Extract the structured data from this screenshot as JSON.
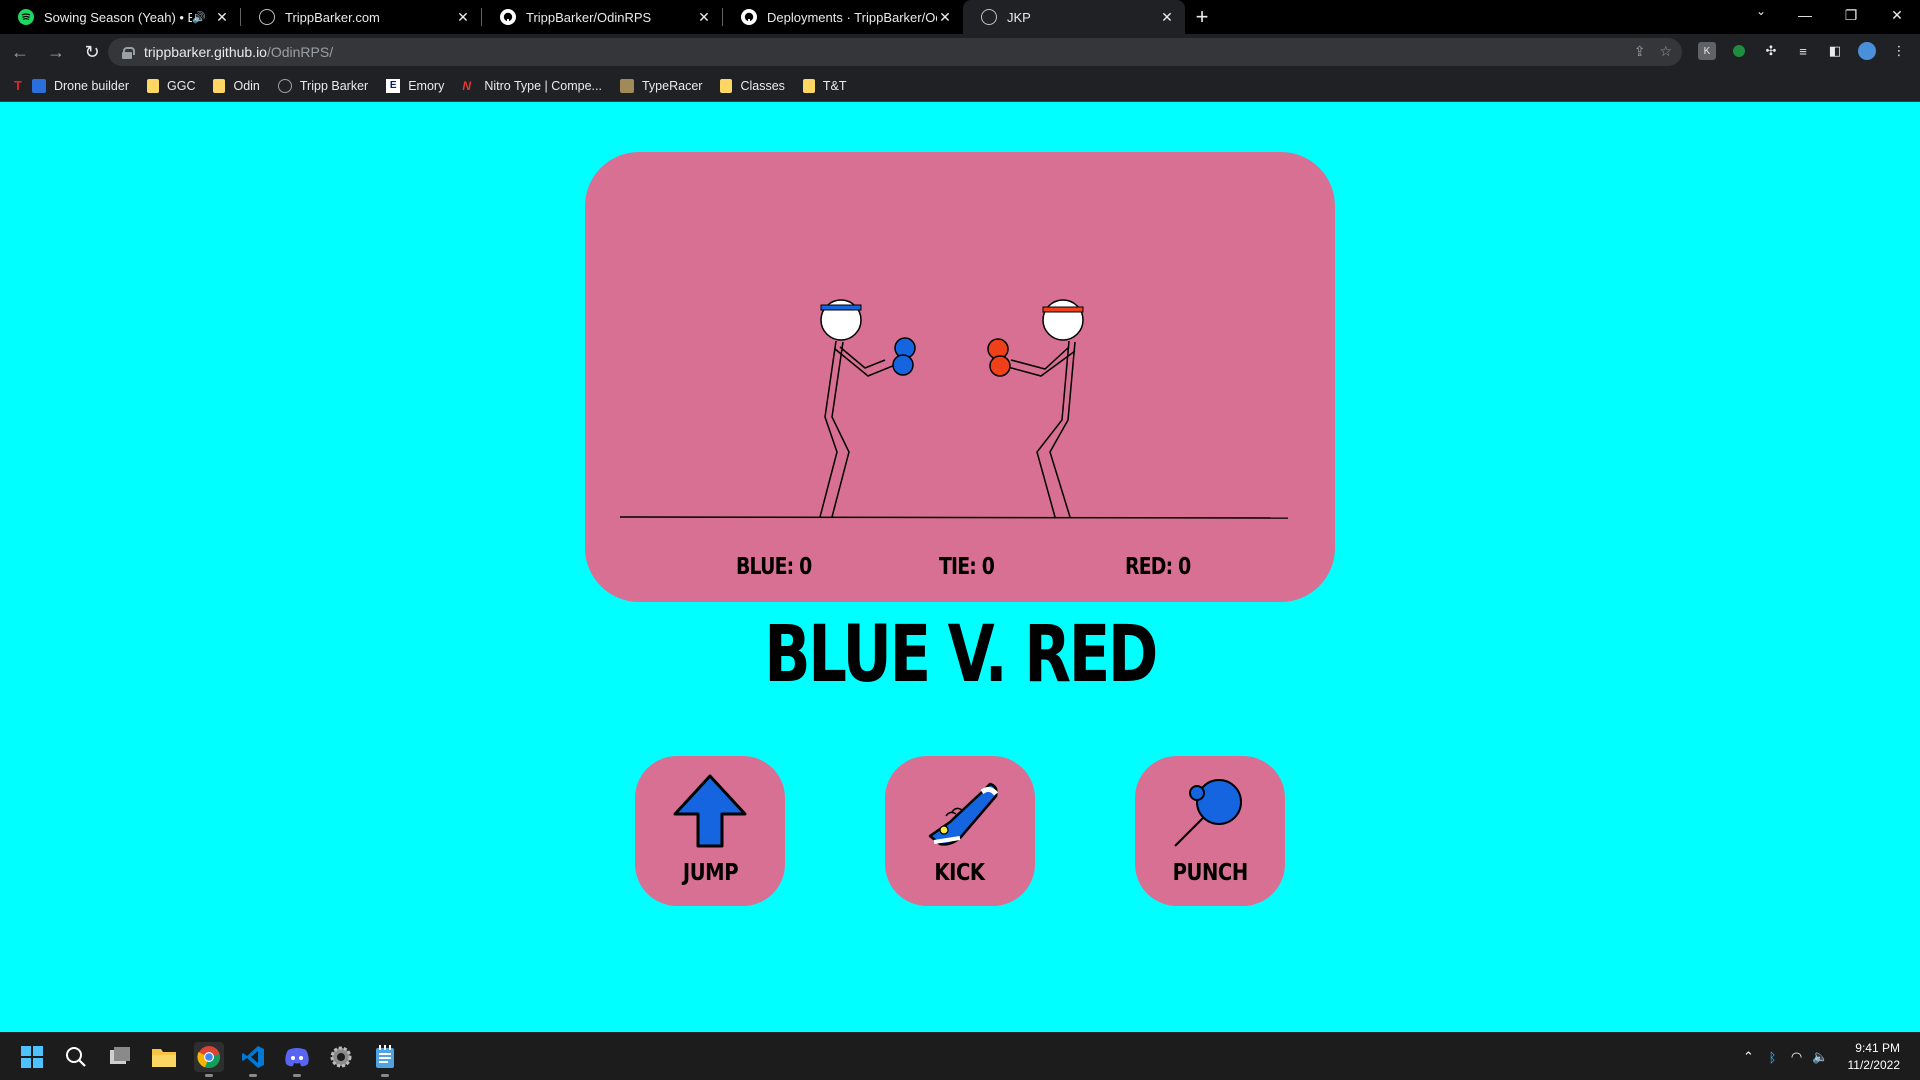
{
  "browser": {
    "tabs": [
      {
        "title": "Sowing Season (Yeah) • Bran",
        "icon": "spotify-icon",
        "audio": true,
        "active": false
      },
      {
        "title": "TrippBarker.com",
        "icon": "globe-icon",
        "active": false
      },
      {
        "title": "TrippBarker/OdinRPS",
        "icon": "github-icon",
        "active": false
      },
      {
        "title": "Deployments · TrippBarker/OdinF",
        "icon": "github-icon",
        "active": false
      },
      {
        "title": "JKP",
        "icon": "globe-icon",
        "active": true
      }
    ],
    "url_host": "trippbarker.github.io",
    "url_path": "/OdinRPS/",
    "bookmarks": [
      {
        "label": "Drone builder",
        "icon": "drone-icon"
      },
      {
        "label": "GGC",
        "icon": "folder-icon"
      },
      {
        "label": "Odin",
        "icon": "folder-icon"
      },
      {
        "label": "Tripp Barker",
        "icon": "globe-icon"
      },
      {
        "label": "Emory",
        "icon": "emory-icon"
      },
      {
        "label": "Nitro Type | Compe...",
        "icon": "nitro-icon"
      },
      {
        "label": "TypeRacer",
        "icon": "typeracer-icon"
      },
      {
        "label": "Classes",
        "icon": "folder-icon"
      },
      {
        "label": "T&T",
        "icon": "folder-icon"
      }
    ]
  },
  "game": {
    "background_color": "#00ffff",
    "panel_color": "#d87093",
    "blue_color": "#1565e0",
    "red_color": "#f0401a",
    "scores": {
      "blue": "BLUE: 0",
      "tie": "TIE: 0",
      "red": "RED: 0"
    },
    "headline": "BLUE V. RED",
    "moves": [
      {
        "label": "JUMP",
        "icon": "up-arrow-icon"
      },
      {
        "label": "KICK",
        "icon": "sneaker-icon"
      },
      {
        "label": "PUNCH",
        "icon": "boxing-glove-icon"
      }
    ]
  },
  "taskbar": {
    "apps": [
      "windows-start-icon",
      "search-icon",
      "task-view-icon",
      "file-explorer-icon",
      "chrome-icon",
      "vscode-icon",
      "discord-icon",
      "settings-icon",
      "notepad-icon"
    ],
    "time": "9:41 PM",
    "date": "11/2/2022"
  }
}
